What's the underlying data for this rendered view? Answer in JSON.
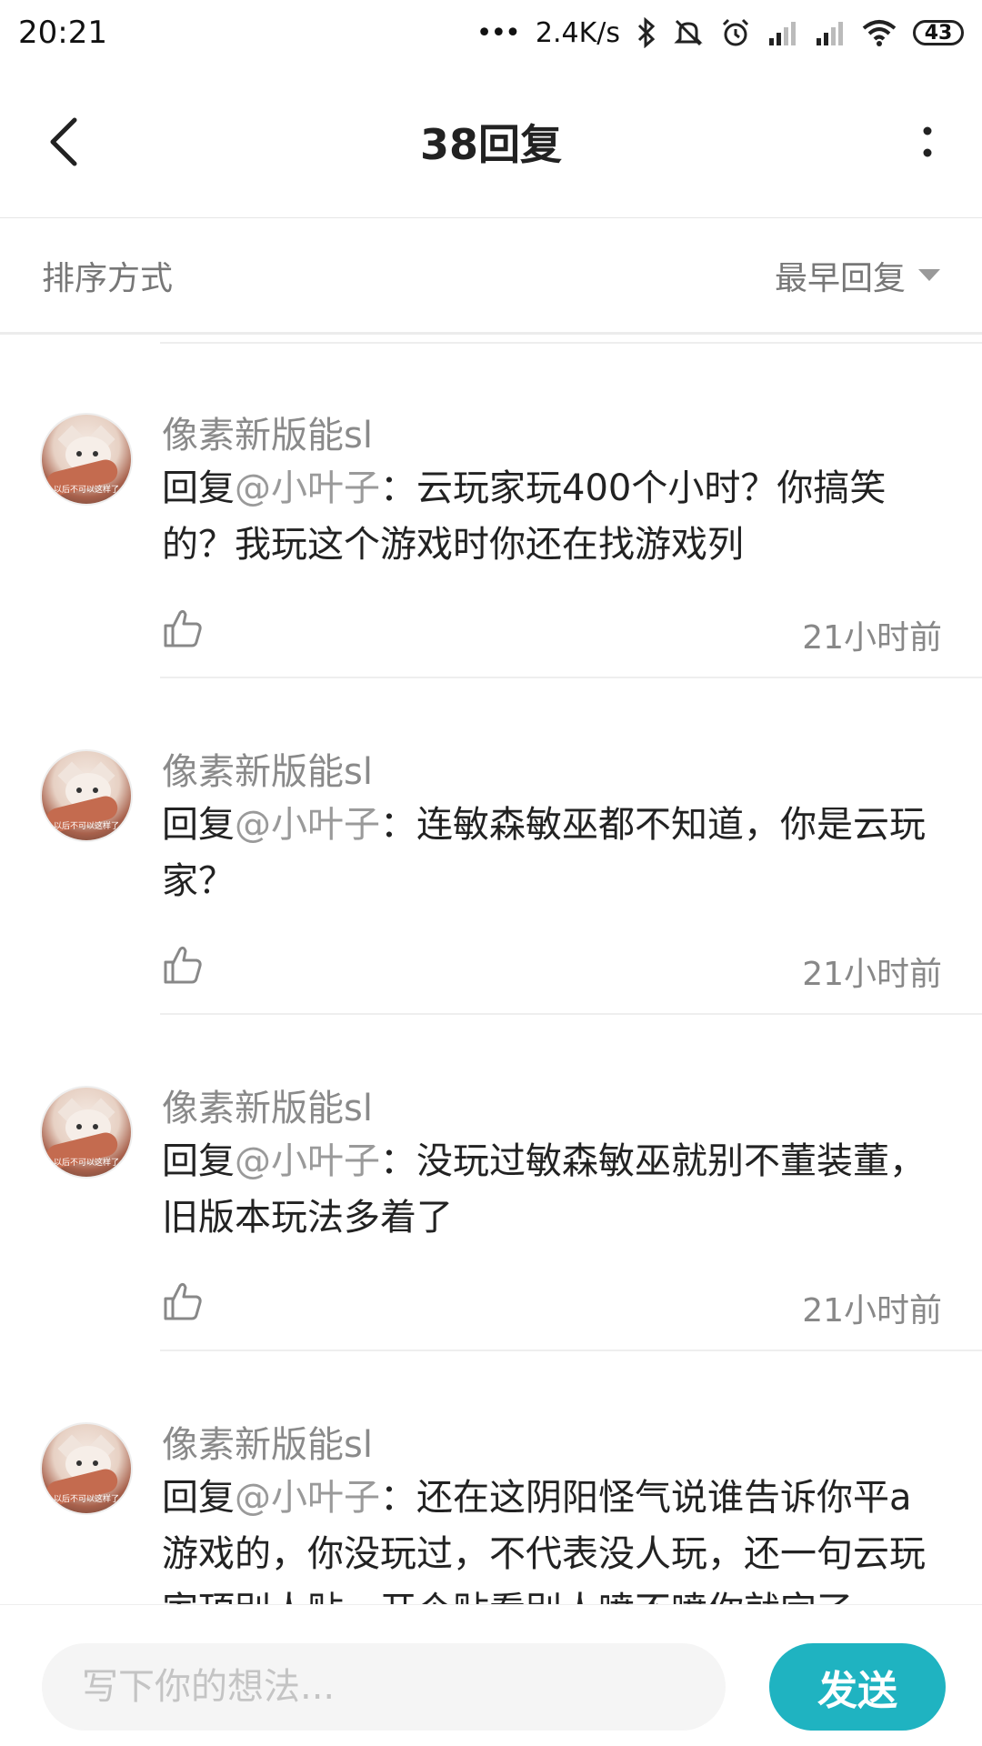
{
  "status_bar": {
    "time": "20:21",
    "dots": "•••",
    "net_speed": "2.4K/s",
    "battery": "43",
    "icons": [
      "bluetooth-icon",
      "mute-bell-icon",
      "alarm-icon",
      "signal-icon",
      "signal-icon",
      "wifi-icon",
      "battery-icon"
    ]
  },
  "header": {
    "title": "38回复",
    "back_icon": "chevron-left-icon",
    "more_icon": "more-vertical-icon"
  },
  "sort": {
    "label": "排序方式",
    "value": "最早回复",
    "icon": "caret-down-icon"
  },
  "replies": [
    {
      "username": "像素新版能sl",
      "prefix": "回复",
      "mention": "@小叶子",
      "text": "：云玩家玩400个小时？你搞笑的？我玩这个游戏时你还在找游戏列",
      "time": "21小时前"
    },
    {
      "username": "像素新版能sl",
      "prefix": "回复",
      "mention": "@小叶子",
      "text": "：连敏森敏巫都不知道，你是云玩家？",
      "time": "21小时前"
    },
    {
      "username": "像素新版能sl",
      "prefix": "回复",
      "mention": "@小叶子",
      "text": "：没玩过敏森敏巫就别不董装董，旧版本玩法多着了",
      "time": "21小时前"
    },
    {
      "username": "像素新版能sl",
      "prefix": "回复",
      "mention": "@小叶子",
      "text": "：还在这阴阳怪气说谁告诉你平a游戏的，你没玩过，不代表没人玩，还一句云玩家顶别人贴，开个贴看别人喷不喷你就完了",
      "time": ""
    }
  ],
  "avatar_caption": "以后不可以这样了",
  "composer": {
    "placeholder": "写下你的想法...",
    "send_label": "发送",
    "accent_color": "#1fb3c1"
  }
}
